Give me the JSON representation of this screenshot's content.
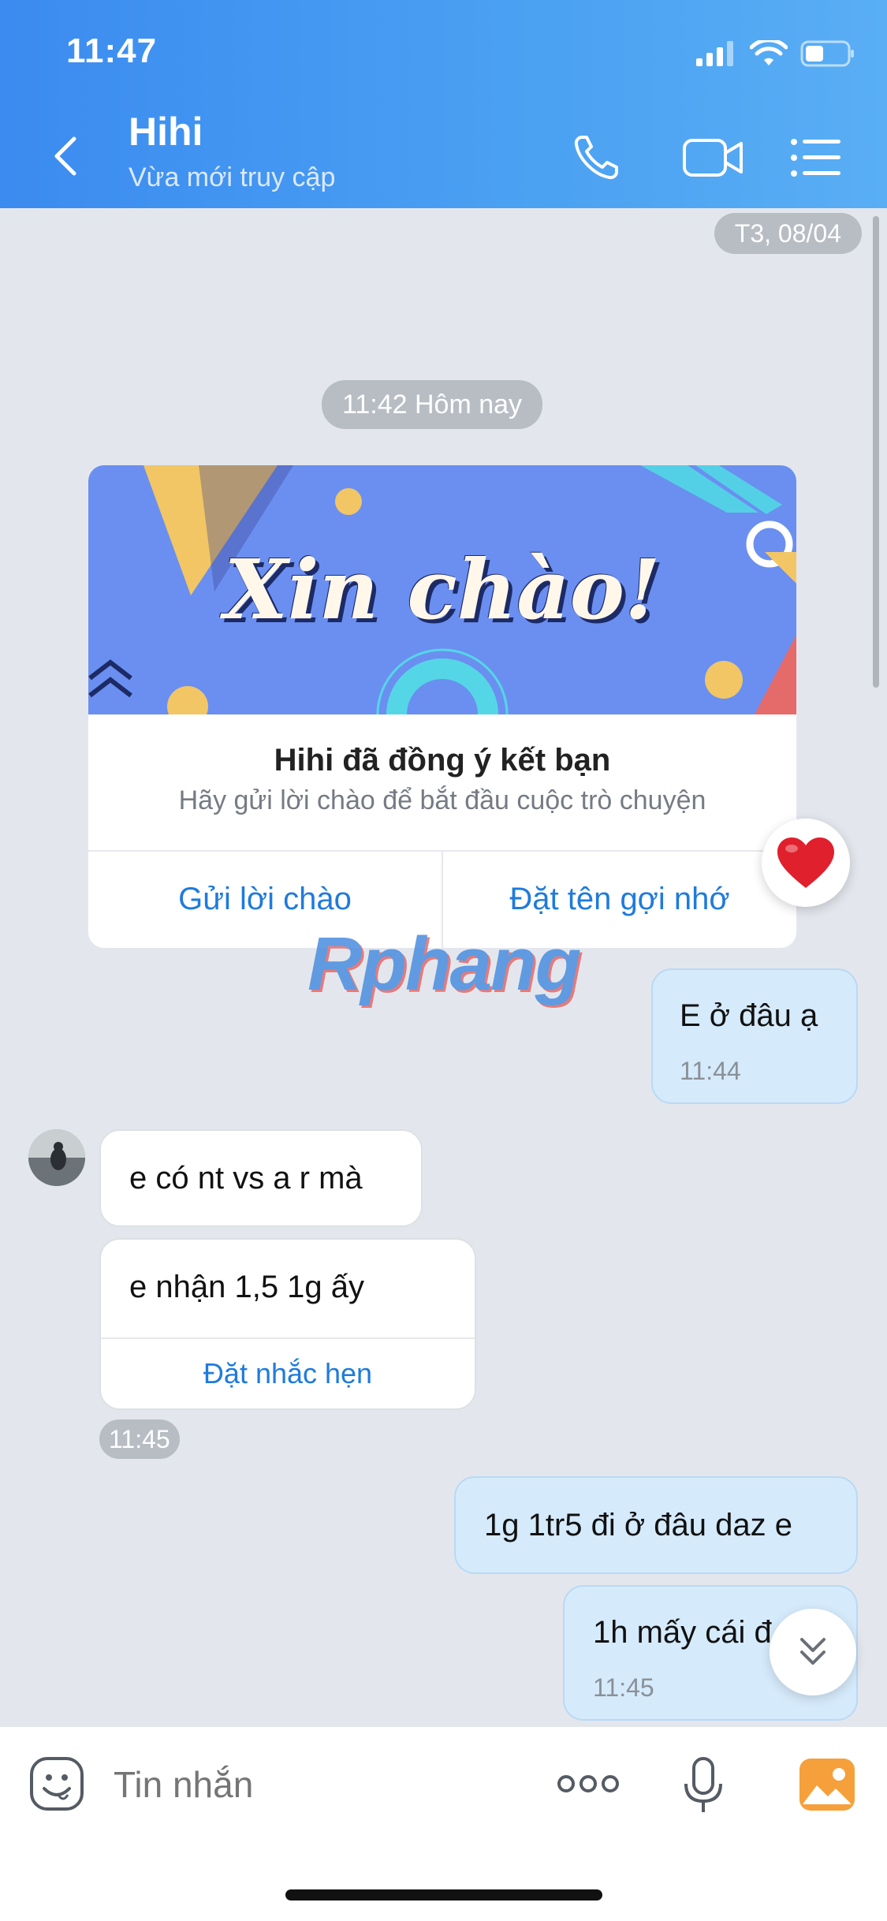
{
  "status_bar": {
    "time": "11:47"
  },
  "header": {
    "contact_name": "Hihi",
    "contact_status": "Vừa mới truy cập"
  },
  "date_separators": {
    "top": "T3, 08/04",
    "today": "11:42 Hôm nay"
  },
  "greeting_card": {
    "banner_text": "Xin chào!",
    "title": "Hihi đã đồng ý kết bạn",
    "subtitle": "Hãy gửi lời chào để bắt đầu cuộc trò chuyện",
    "action_left": "Gửi lời chào",
    "action_right": "Đặt tên gợi nhớ"
  },
  "watermark": "Rphang",
  "messages": [
    {
      "side": "out",
      "text": "E ở đâu ạ",
      "time": "11:44"
    },
    {
      "side": "in",
      "text": "e có nt vs a r mà"
    },
    {
      "side": "in",
      "text": "e nhận 1,5 1g ấy",
      "action": "Đặt nhắc hẹn"
    },
    {
      "side": "in_time",
      "time": "11:45"
    },
    {
      "side": "out",
      "text": "1g 1tr5 đi ở đâu daz e"
    },
    {
      "side": "out",
      "text": "1h mấy cái đ",
      "time": "11:45"
    }
  ],
  "input": {
    "placeholder": "Tin nhắn"
  },
  "colors": {
    "header": "#3b8bf0",
    "outgoing_bubble": "#d5eafb",
    "link": "#1f7bdc",
    "background": "#e3e7ed"
  }
}
